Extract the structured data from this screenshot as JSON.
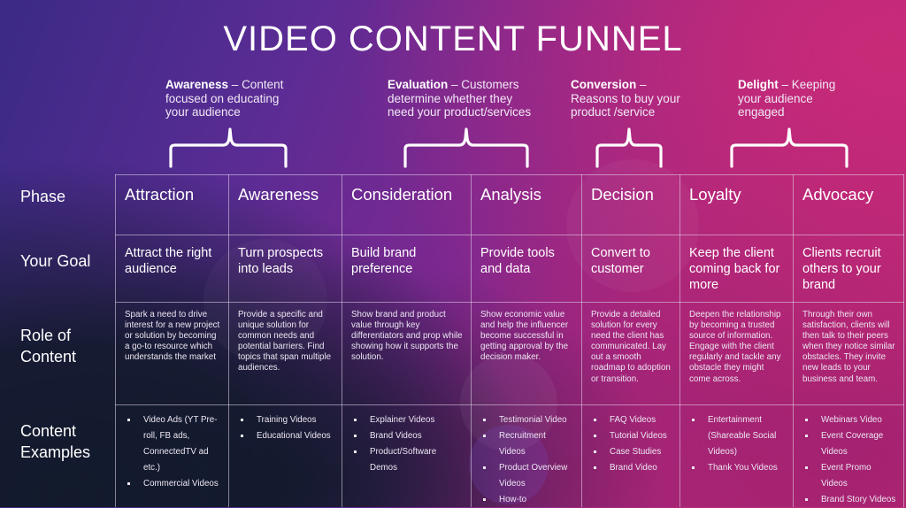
{
  "title": "VIDEO CONTENT FUNNEL",
  "stages": [
    {
      "bold": "Awareness",
      "sep": " – ",
      "line1_rest": "Content",
      "line2": "focused on educating",
      "line3": "your audience"
    },
    {
      "bold": "Evaluation",
      "sep": " – ",
      "line1_rest": "Customers",
      "line2": "determine whether they",
      "line3": "need your product/services"
    },
    {
      "bold": "Conversion",
      "sep": " –",
      "line1_rest": "",
      "line2": "Reasons to buy your",
      "line3": "product /service"
    },
    {
      "bold": "Delight",
      "sep": " – ",
      "line1_rest": "Keeping",
      "line2": "your audience",
      "line3": "engaged"
    }
  ],
  "row_labels": {
    "phase": "Phase",
    "goal": "Your Goal",
    "role_line1": "Role of",
    "role_line2": "Content",
    "examples_line1": "Content",
    "examples_line2": "Examples"
  },
  "columns": [
    {
      "phase": "Attraction",
      "goal": "Attract the right audience",
      "role": "Spark a need to drive interest for a new project or solution by becoming a go-to resource which understands the market",
      "examples": [
        "Video Ads (YT Pre-roll, FB ads, ConnectedTV ad etc.)",
        "Commercial Videos"
      ]
    },
    {
      "phase": "Awareness",
      "goal": "Turn prospects into leads",
      "role": "Provide a specific and unique solution for common needs and potential barriers. Find topics that span multiple audiences.",
      "examples": [
        "Training Videos",
        "Educational Videos"
      ]
    },
    {
      "phase": "Consideration",
      "goal": "Build brand preference",
      "role": "Show brand and product value through key differentiators and prop while showing how it supports the solution.",
      "examples": [
        "Explainer Videos",
        "Brand Videos",
        "Product/Software Demos"
      ]
    },
    {
      "phase": "Analysis",
      "goal": "Provide tools and data",
      "role": "Show economic value and help the influencer become successful in getting approval by the decision maker.",
      "examples": [
        "Testimonial Video",
        "Recruitment Videos",
        "Product Overview Videos",
        "How-to"
      ]
    },
    {
      "phase": "Decision",
      "goal": "Convert to customer",
      "role": "Provide a detailed solution for every need the client has communicated. Lay out a smooth roadmap to adoption or transition.",
      "examples": [
        "FAQ Videos",
        "Tutorial Videos",
        "Case Studies",
        "Brand Video"
      ]
    },
    {
      "phase": "Loyalty",
      "goal": "Keep the client coming back for more",
      "role": "Deepen the relationship by becoming a trusted source of information. Engage with the client regularly and tackle any obstacle they might come across.",
      "examples": [
        "Entertainment (Shareable Social Videos)",
        "Thank You Videos"
      ]
    },
    {
      "phase": "Advocacy",
      "goal": "Clients recruit others to your brand",
      "role": "Through their own satisfaction, clients will then talk to their peers when they notice similar obstacles. They invite new leads to your business and team.",
      "examples": [
        "Webinars Video",
        "Event Coverage Videos",
        "Event Promo Videos",
        "Brand Story Videos"
      ]
    }
  ]
}
